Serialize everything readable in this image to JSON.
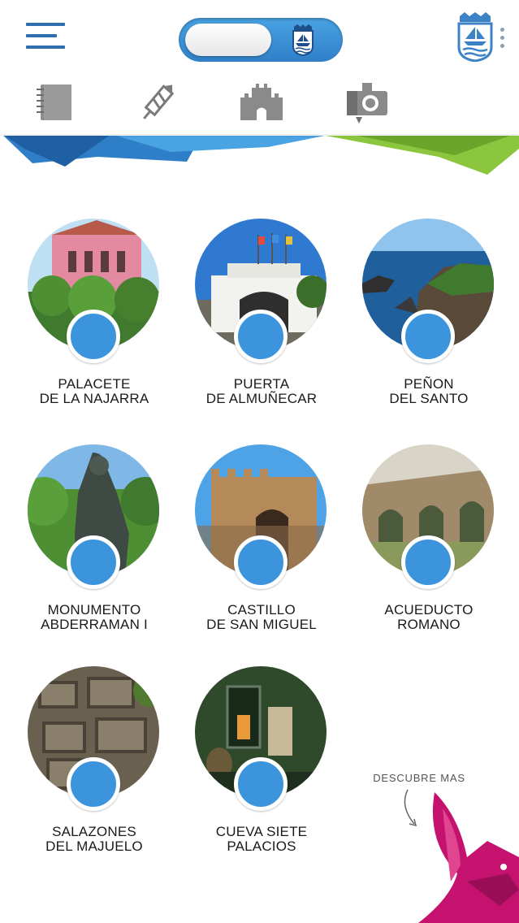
{
  "header": {
    "menu_icon": "hamburger-menu-icon",
    "toggle_icon": "town-crest-icon",
    "crest_icon": "town-crest-icon",
    "more_icon": "vertical-dots-icon",
    "categories": [
      {
        "icon": "notebook-icon"
      },
      {
        "icon": "firework-rocket-icon"
      },
      {
        "icon": "castle-icon"
      },
      {
        "icon": "camera-icon"
      }
    ]
  },
  "items": [
    {
      "line1": "PALACETE",
      "line2": "DE LA NAJARRA"
    },
    {
      "line1": "PUERTA",
      "line2": "DE ALMUÑECAR"
    },
    {
      "line1": "PEÑON",
      "line2": "DEL SANTO"
    },
    {
      "line1": "MONUMENTO",
      "line2": "ABDERRAMAN I"
    },
    {
      "line1": "CASTILLO",
      "line2": "DE SAN MIGUEL"
    },
    {
      "line1": "ACUEDUCTO",
      "line2": "ROMANO"
    },
    {
      "line1": "SALAZONES",
      "line2": "DEL MAJUELO"
    },
    {
      "line1": "CUEVA SIETE",
      "line2": "PALACIOS"
    }
  ],
  "footer": {
    "descubre": "DESCUBRE MAS",
    "mascot_icon": "phoenix-bird-icon"
  },
  "colors": {
    "accent_blue": "#3c94dc",
    "banner_green": "#8cc63f",
    "mascot_magenta": "#c4126e"
  }
}
